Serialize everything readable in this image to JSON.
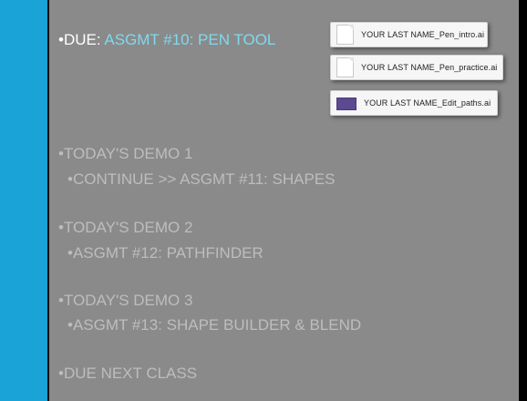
{
  "colors": {
    "slide_background": "#8a8a8a",
    "accent_bar": "#1aa3d6",
    "accent_text": "#7fd9ee",
    "dim_text": "#bdbdbd"
  },
  "due": {
    "prefix": "•DUE: ",
    "assignment": "ASGMT #10: PEN TOOL"
  },
  "files": [
    {
      "name": "YOUR LAST NAME_Pen_intro.ai",
      "icon": "document-icon"
    },
    {
      "name": "YOUR LAST NAME_Pen_practice.ai",
      "icon": "document-icon"
    },
    {
      "name": "YOUR LAST NAME_Edit_paths.ai",
      "icon": "image-thumbnail-icon"
    }
  ],
  "agenda": [
    {
      "heading": "•TODAY'S DEMO 1",
      "item": "•CONTINUE  >> ASGMT #11: SHAPES"
    },
    {
      "heading": "•TODAY'S DEMO 2",
      "item": "•ASGMT #12: PATHFINDER"
    },
    {
      "heading": "•TODAY'S DEMO 3",
      "item": "•ASGMT #13: SHAPE BUILDER & BLEND"
    }
  ],
  "due_next": "•DUE NEXT CLASS"
}
